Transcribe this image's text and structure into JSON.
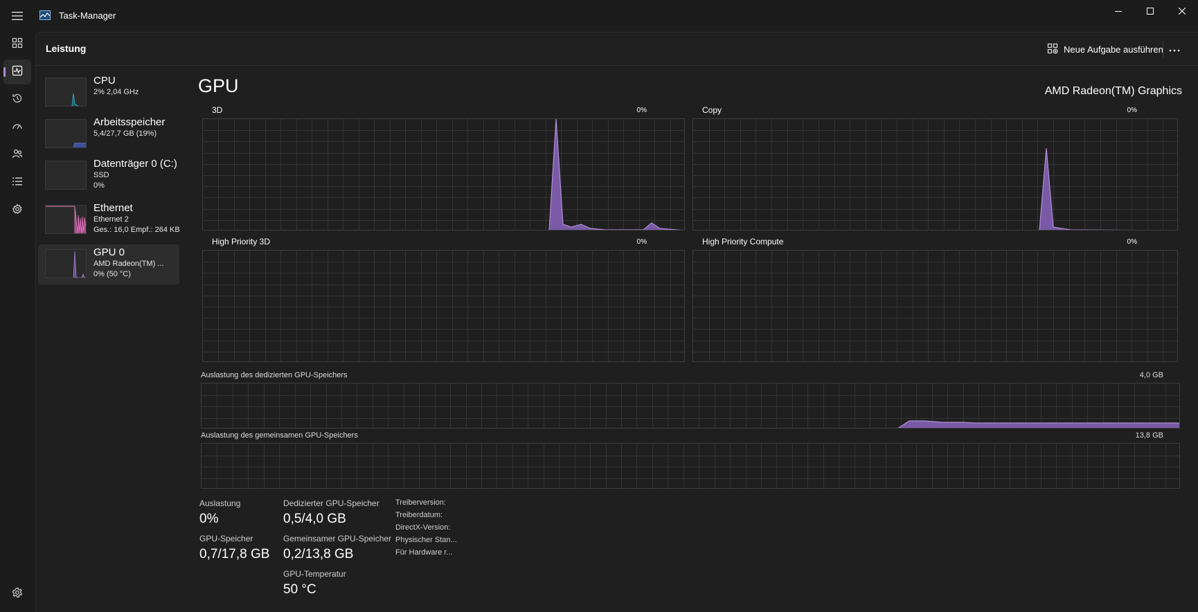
{
  "window": {
    "title": "Task-Manager"
  },
  "header": {
    "title": "Leistung",
    "run_task_label": "Neue Aufgabe ausführen"
  },
  "colors": {
    "accent": "#b08fd6",
    "cpu": "#2aa9b8",
    "memory": "#5b78d9",
    "disk": "#3bb58a",
    "ethernet": "#e77fc0",
    "gpu": "#a680d0"
  },
  "resources": [
    {
      "name": "CPU",
      "line1": "2% 2,04 GHz",
      "line2": ""
    },
    {
      "name": "Arbeitsspeicher",
      "line1": "5,4/27,7 GB (19%)",
      "line2": ""
    },
    {
      "name": "Datenträger 0 (C:)",
      "line1": "SSD",
      "line2": "0%"
    },
    {
      "name": "Ethernet",
      "line1": "Ethernet 2",
      "line2": "Ges.: 16,0 Empf.: 264 KB"
    },
    {
      "name": "GPU 0",
      "line1": "AMD Radeon(TM) ...",
      "line2": "0% (50 °C)"
    }
  ],
  "gpu": {
    "title": "GPU",
    "model": "AMD Radeon(TM) Graphics",
    "engines": [
      {
        "label": "3D",
        "pct": "0%"
      },
      {
        "label": "Copy",
        "pct": "0%"
      },
      {
        "label": "High Priority 3D",
        "pct": "0%"
      },
      {
        "label": "High Priority Compute",
        "pct": "0%"
      }
    ],
    "dedicated_memory": {
      "label": "Auslastung des dedizierten GPU-Speichers",
      "max": "4,0 GB"
    },
    "shared_memory": {
      "label": "Auslastung des gemeinsamen GPU-Speichers",
      "max": "13,8 GB"
    },
    "stats": {
      "utilization": {
        "label": "Auslastung",
        "value": "0%"
      },
      "gpu_memory": {
        "label": "GPU-Speicher",
        "value": "0,7/17,8 GB"
      },
      "dedicated": {
        "label": "Dedizierter GPU-Speicher",
        "value": "0,5/4,0 GB"
      },
      "shared": {
        "label": "Gemeinsamer GPU-Speicher",
        "value": "0,2/13,8 GB"
      },
      "temperature": {
        "label": "GPU-Temperatur",
        "value": "50 °C"
      }
    },
    "info_labels": [
      "Treiberversion:",
      "Treiberdatum:",
      "DirectX-Version:",
      "Physischer Stan...",
      "Für Hardware r..."
    ]
  }
}
